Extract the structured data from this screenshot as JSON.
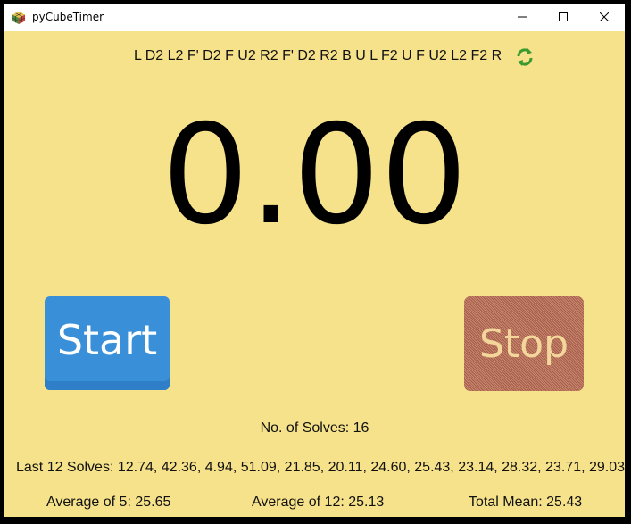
{
  "window": {
    "title": "pyCubeTimer",
    "icons": {
      "app": "rubiks-cube-icon",
      "minimize": "minimize-icon",
      "maximize": "maximize-icon",
      "close": "close-icon"
    }
  },
  "scramble": {
    "text": "L D2 L2 F' D2 F U2 R2 F' D2 R2 B U L F2 U F U2 L2 F2 R",
    "refresh_icon": "refresh-icon"
  },
  "timer": {
    "value": "0.00"
  },
  "buttons": {
    "start_label": "Start",
    "stop_label": "Stop"
  },
  "stats": {
    "solves_count": "No. of Solves: 16",
    "last12": "Last 12 Solves: 12.74, 42.36, 4.94, 51.09, 21.85, 20.11, 24.60, 25.43, 23.14, 28.32, 23.71, 29.03",
    "avg5": "Average of 5: 25.65",
    "avg12": "Average of 12: 25.13",
    "mean": "Total Mean: 25.43"
  },
  "colors": {
    "background": "#f6e28a",
    "start_button": "#3a8fd9",
    "stop_button": "#b06a58"
  }
}
